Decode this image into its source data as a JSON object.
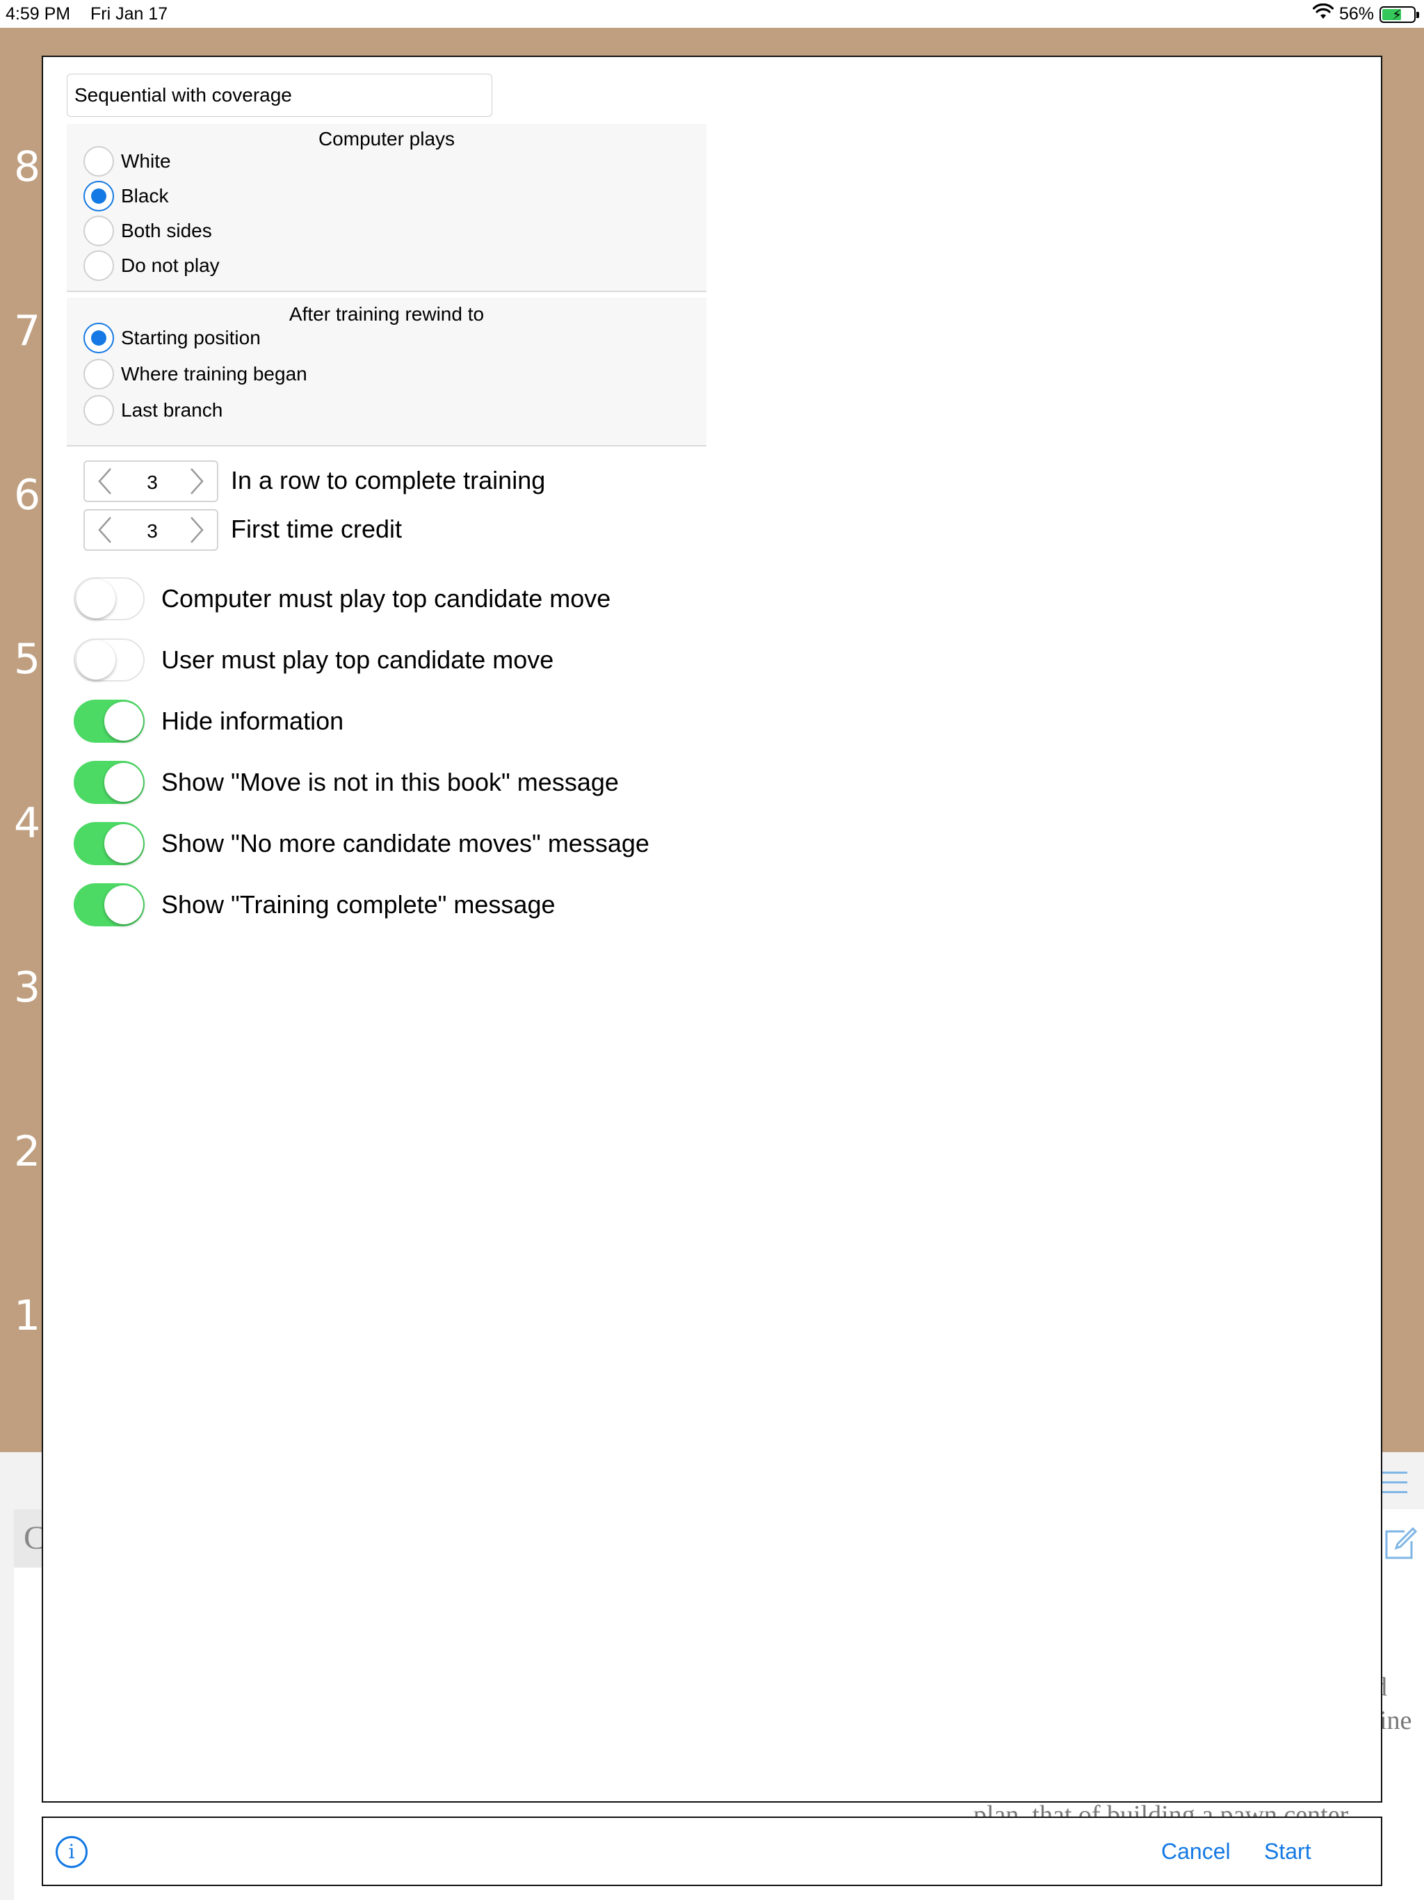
{
  "status_bar": {
    "time": "4:59 PM",
    "date": "Fri Jan 17",
    "battery": "56%",
    "battery_level": 0.56
  },
  "board": {
    "ranks": [
      "8",
      "7",
      "6",
      "5",
      "4",
      "3",
      "2",
      "1"
    ]
  },
  "background_panel": {
    "c_letter": "C",
    "text_fragments": [
      "d",
      "ine",
      "plan, that of building a pawn center"
    ]
  },
  "dialog": {
    "training_mode": "Sequential with coverage",
    "computer_plays": {
      "title": "Computer plays",
      "options": [
        "White",
        "Black",
        "Both sides",
        "Do not play"
      ],
      "selected_index": 1
    },
    "rewind": {
      "title": "After training rewind to",
      "options": [
        "Starting position",
        "Where training began",
        "Last branch"
      ],
      "selected_index": 0
    },
    "steppers": [
      {
        "value": "3",
        "label": "In a row to complete training"
      },
      {
        "value": "3",
        "label": "First time credit"
      }
    ],
    "toggles": [
      {
        "label": "Computer must play top candidate move",
        "on": false
      },
      {
        "label": "User must play top candidate move",
        "on": false
      },
      {
        "label": "Hide information",
        "on": true
      },
      {
        "label": "Show \"Move is not in this book\" message",
        "on": true
      },
      {
        "label": "Show \"No more candidate moves\" message",
        "on": true
      },
      {
        "label": "Show \"Training complete\" message",
        "on": true
      }
    ]
  },
  "bottom_bar": {
    "info_label": "i",
    "cancel_label": "Cancel",
    "start_label": "Start"
  },
  "colors": {
    "accent": "#1479e4",
    "toggle_on": "#4cd964",
    "board": "#bf9f80"
  }
}
